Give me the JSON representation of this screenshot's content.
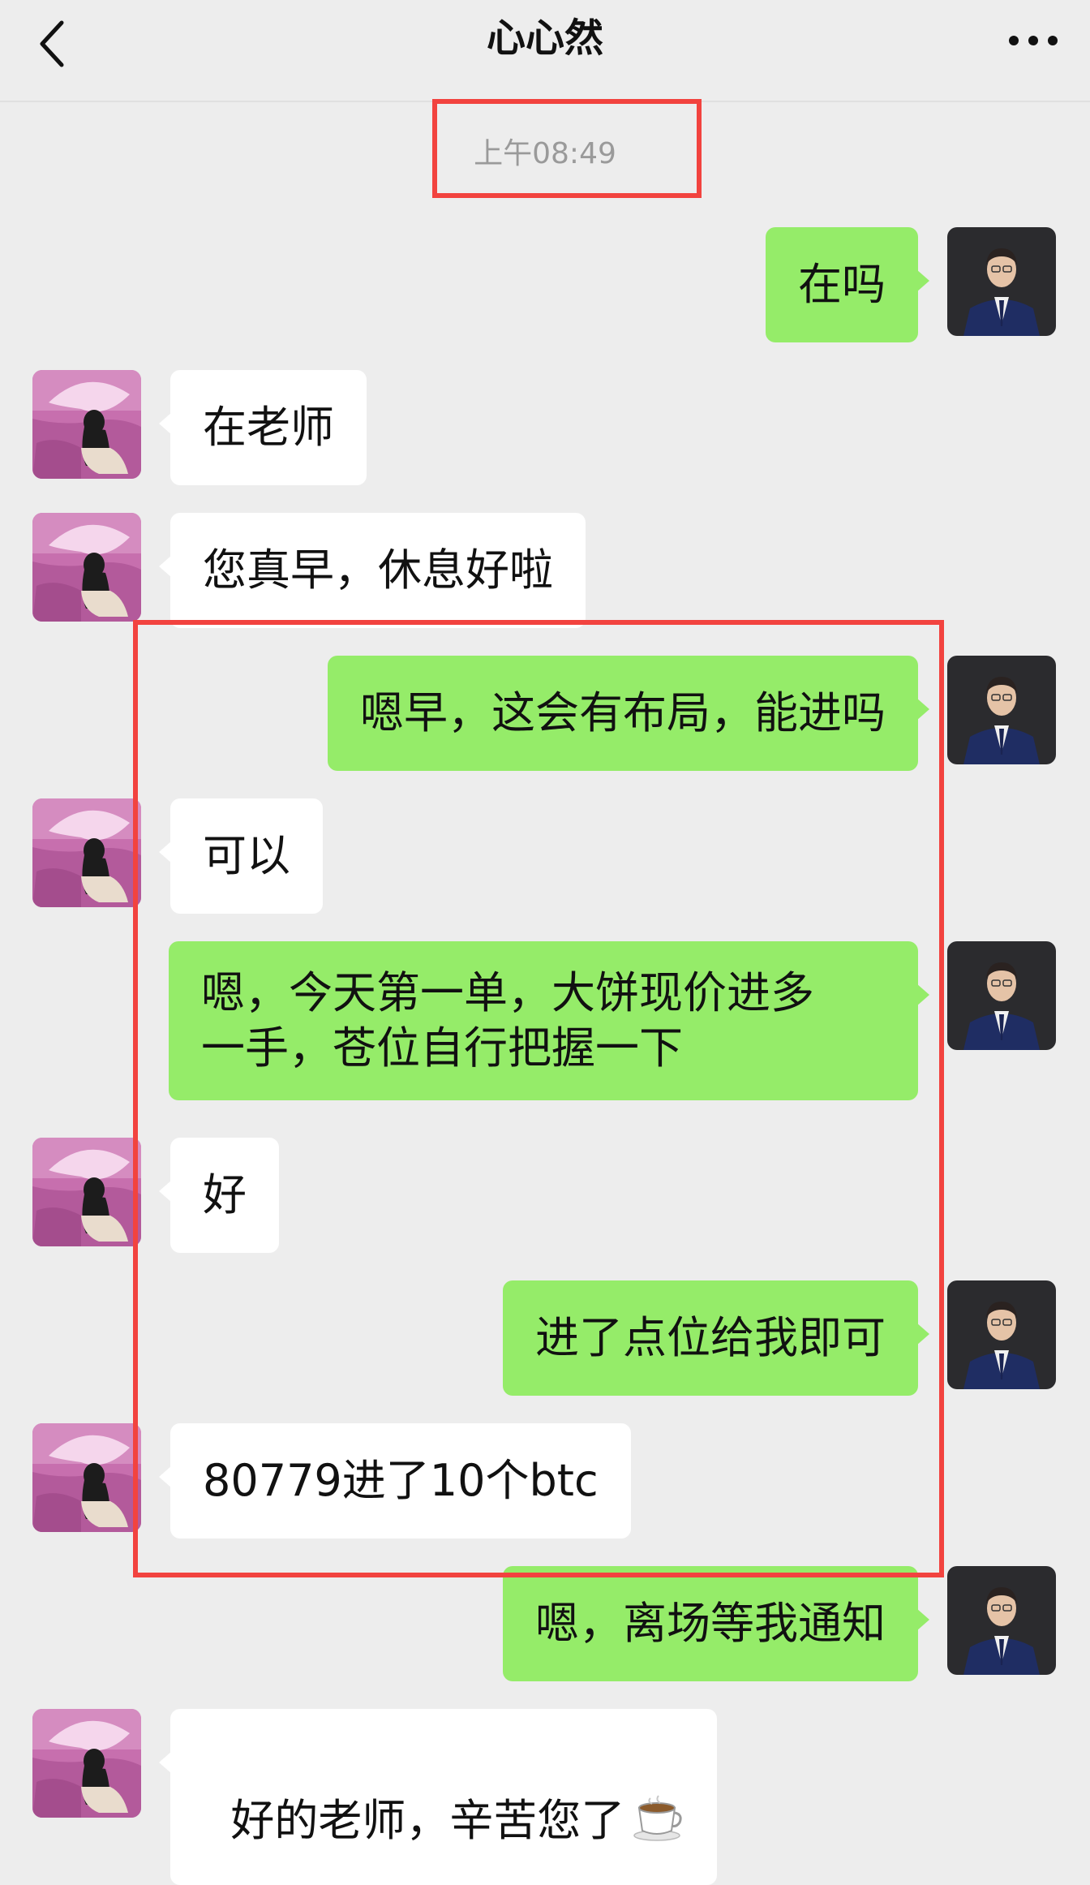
{
  "header": {
    "title": "心心然",
    "back_icon": "chevron-left-icon",
    "more_icon": "more-horizontal-icon"
  },
  "timestamp": "上午08:49",
  "colors": {
    "background": "#ededed",
    "self_bubble": "#95ec69",
    "peer_bubble": "#ffffff",
    "annotation": "#f2433f"
  },
  "messages": [
    {
      "sender": "self",
      "text": "在吗"
    },
    {
      "sender": "peer",
      "text": "在老师"
    },
    {
      "sender": "peer",
      "text": "您真早，休息好啦"
    },
    {
      "sender": "self",
      "text": "嗯早，这会有布局，能进吗"
    },
    {
      "sender": "peer",
      "text": "可以"
    },
    {
      "sender": "self",
      "text": "嗯，今天第一单，大饼现价进多\n一手，苍位自行把握一下"
    },
    {
      "sender": "peer",
      "text": "好"
    },
    {
      "sender": "self",
      "text": "进了点位给我即可"
    },
    {
      "sender": "peer",
      "text": "80779进了10个btc"
    },
    {
      "sender": "self",
      "text": "嗯，离场等我通知"
    },
    {
      "sender": "peer",
      "text": "好的老师，辛苦您了",
      "emoji": "coffee-icon"
    }
  ]
}
